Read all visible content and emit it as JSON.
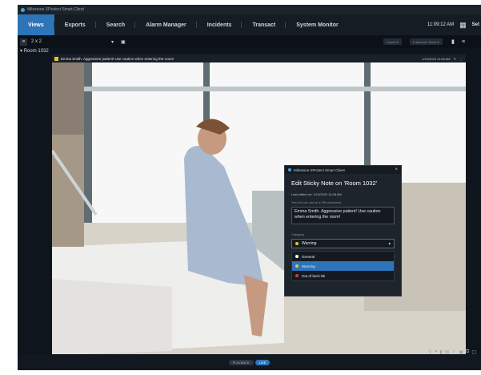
{
  "window": {
    "title": "Milestone XProtect Smart Client"
  },
  "nav": {
    "tabs": [
      {
        "label": "Views",
        "active": true
      },
      {
        "label": "Exports",
        "active": false
      },
      {
        "label": "Search",
        "active": false
      },
      {
        "label": "Alarm Manager",
        "active": false
      },
      {
        "label": "Incidents",
        "active": false
      },
      {
        "label": "Transact",
        "active": false
      },
      {
        "label": "System Monitor",
        "active": false
      }
    ],
    "time": "11:09:12 AM",
    "setup_label": "Set"
  },
  "toolbar": {
    "layout": "2 x 2",
    "export_label": "Export",
    "fullscreen_label": "Fullscreen Mode"
  },
  "view": {
    "room_label": "Room 1032",
    "sticky_text": "Emma Smith. Aggressive patient! Use caution when entering the room!",
    "timestamp": "1/10/2023 11:08 AM"
  },
  "dialog": {
    "window_title": "Milestone XProtect Smart Client",
    "heading": "Edit Sticky Note on 'Room 1032'",
    "last_edited": "Last edited on: 1/10/2023 11:08 AM",
    "hint": "Text (You can add up to 256 characters)",
    "text_value": "Emma Smith. Aggressive patient! Use caution when entering the room!",
    "category_label": "Category",
    "selected": "Warning",
    "options": [
      {
        "label": "General",
        "color": "#ffffff",
        "selected": false
      },
      {
        "label": "Warning",
        "color": "#e9c23a",
        "selected": true
      },
      {
        "label": "Out of bed risk",
        "color": "#d23a3a",
        "selected": false
      }
    ]
  },
  "bottom": {
    "playback_label": "PLAYBACK",
    "live_label": "LIVE"
  },
  "colors": {
    "accent": "#2d74b8",
    "warning": "#e9c23a",
    "danger": "#d23a3a"
  }
}
